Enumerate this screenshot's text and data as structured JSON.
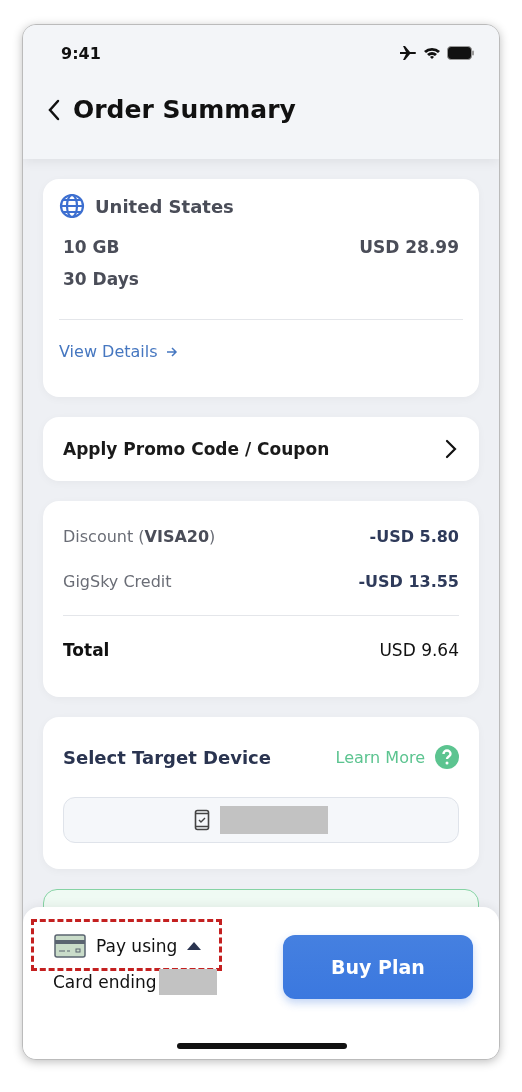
{
  "status_bar": {
    "time": "9:41"
  },
  "header": {
    "title": "Order Summary"
  },
  "plan_card": {
    "country": "United States",
    "data": "10 GB",
    "duration": "30 Days",
    "price": "USD 28.99",
    "link": "View Details"
  },
  "promo": {
    "label": "Apply Promo Code / Coupon"
  },
  "charges": {
    "rows": [
      {
        "label": "Discount (**VISA20**)",
        "amount": "-USD 5.80"
      },
      {
        "label": "GigSky Credit",
        "amount": "-USD 13.55"
      }
    ],
    "total": {
      "label": "Total",
      "amount": "USD 9.64"
    }
  },
  "device": {
    "title": "Select Target Device",
    "link": "Learn More"
  },
  "payment": {
    "label": "Pay using",
    "card_label": "Card ending",
    "button": "Buy Plan"
  }
}
